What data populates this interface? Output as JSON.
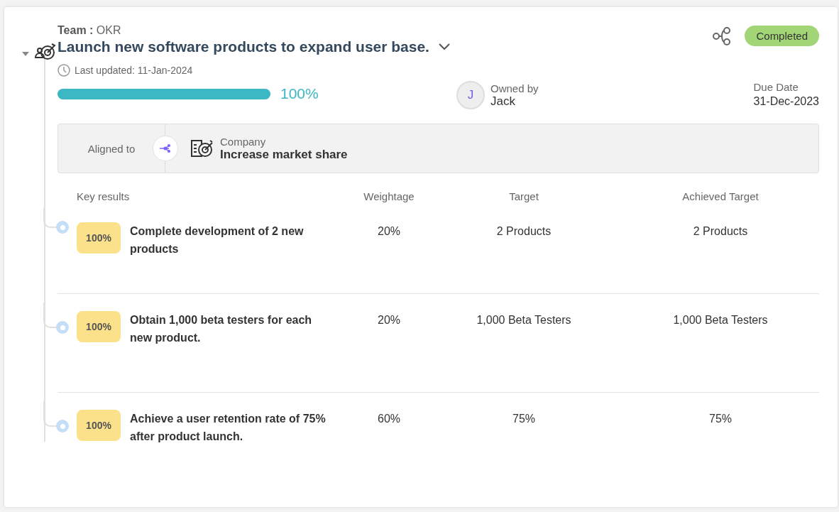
{
  "objective": {
    "team_label": "Team :",
    "team": "OKR",
    "title": "Launch new software products to expand user base.",
    "expanded": true,
    "last_updated": "Last updated: 11-Jan-2024",
    "level": 1,
    "progress": "100%",
    "status": "Completed",
    "owner_label": "Owned by",
    "owner_initial": "J",
    "owner": "Jack",
    "due_label": "Due Date",
    "due_date": "31-Dec-2023"
  },
  "alignment": {
    "label": "Aligned to",
    "level_name": "Company",
    "objective": "Increase market share"
  },
  "key_results": {
    "columns": [
      "Key results",
      "Weightage",
      "Target",
      "Achieved Target"
    ],
    "rows": [
      {
        "progress": "100%",
        "title": "Complete development of 2 new products",
        "weightage": "20%",
        "target": "2 Products",
        "achieved": "2 Products"
      },
      {
        "progress": "100%",
        "title": "Obtain 1,000 beta testers for each new product.",
        "weightage": "20%",
        "target": "1,000 Beta Testers",
        "achieved": "1,000 Beta Testers"
      },
      {
        "progress": "100%",
        "title": "Achieve a user retention rate of 75% after product launch.",
        "weightage": "60%",
        "target": "75%",
        "achieved": "75%"
      }
    ]
  }
}
